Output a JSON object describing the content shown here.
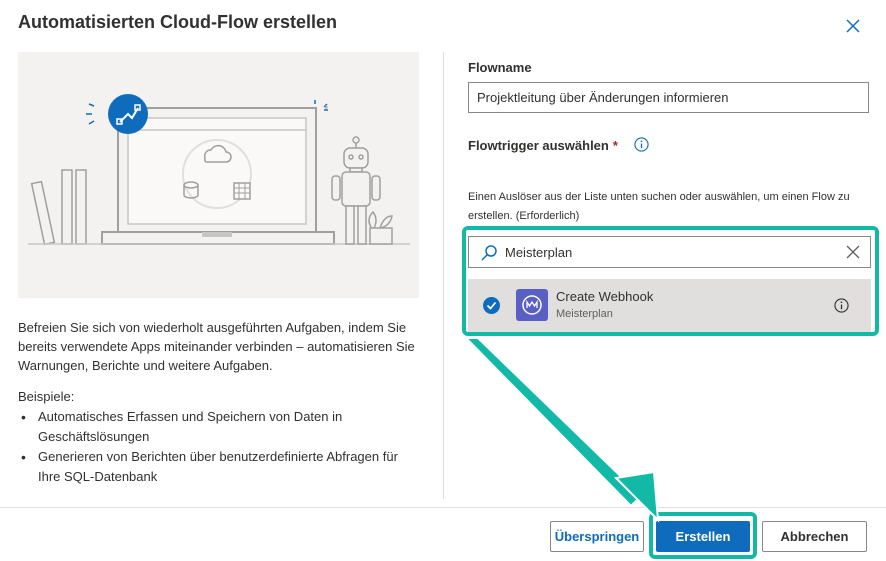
{
  "dialog": {
    "title": "Automatisierten Cloud-Flow erstellen"
  },
  "intro": {
    "description": "Befreien Sie sich von wiederholt ausgeführten Aufgaben, indem Sie bereits verwendete Apps miteinander verbinden – automatisieren Sie Warnungen, Berichte und weitere Aufgaben.",
    "examples_heading": "Beispiele:",
    "examples": [
      "Automatisches Erfassen und Speichern von Daten in Geschäftslösungen",
      "Generieren von Berichten über benutzerdefinierte Abfragen für Ihre SQL-Datenbank"
    ]
  },
  "form": {
    "flowname_label": "Flowname",
    "flowname_value": "Projektleitung über Änderungen informieren",
    "trigger_label": "Flowtrigger auswählen",
    "required_mark": "*",
    "trigger_help": "Einen Auslöser aus der Liste unten suchen oder auswählen, um einen Flow zu erstellen. (Erforderlich)",
    "search_value": "Meisterplan",
    "results": [
      {
        "title": "Create Webhook",
        "connector": "Meisterplan",
        "selected": true
      }
    ]
  },
  "footer": {
    "skip_label": "Überspringen",
    "create_label": "Erstellen",
    "cancel_label": "Abbrechen"
  },
  "colors": {
    "accent": "#0f6cbd",
    "highlight": "#13b9a7",
    "connector": "#5a5fc4"
  },
  "icons": {
    "close": "close-icon",
    "info": "info-icon",
    "search": "search-icon",
    "clear": "clear-icon",
    "check": "checkmark-icon",
    "connector": "meisterplan-icon"
  }
}
